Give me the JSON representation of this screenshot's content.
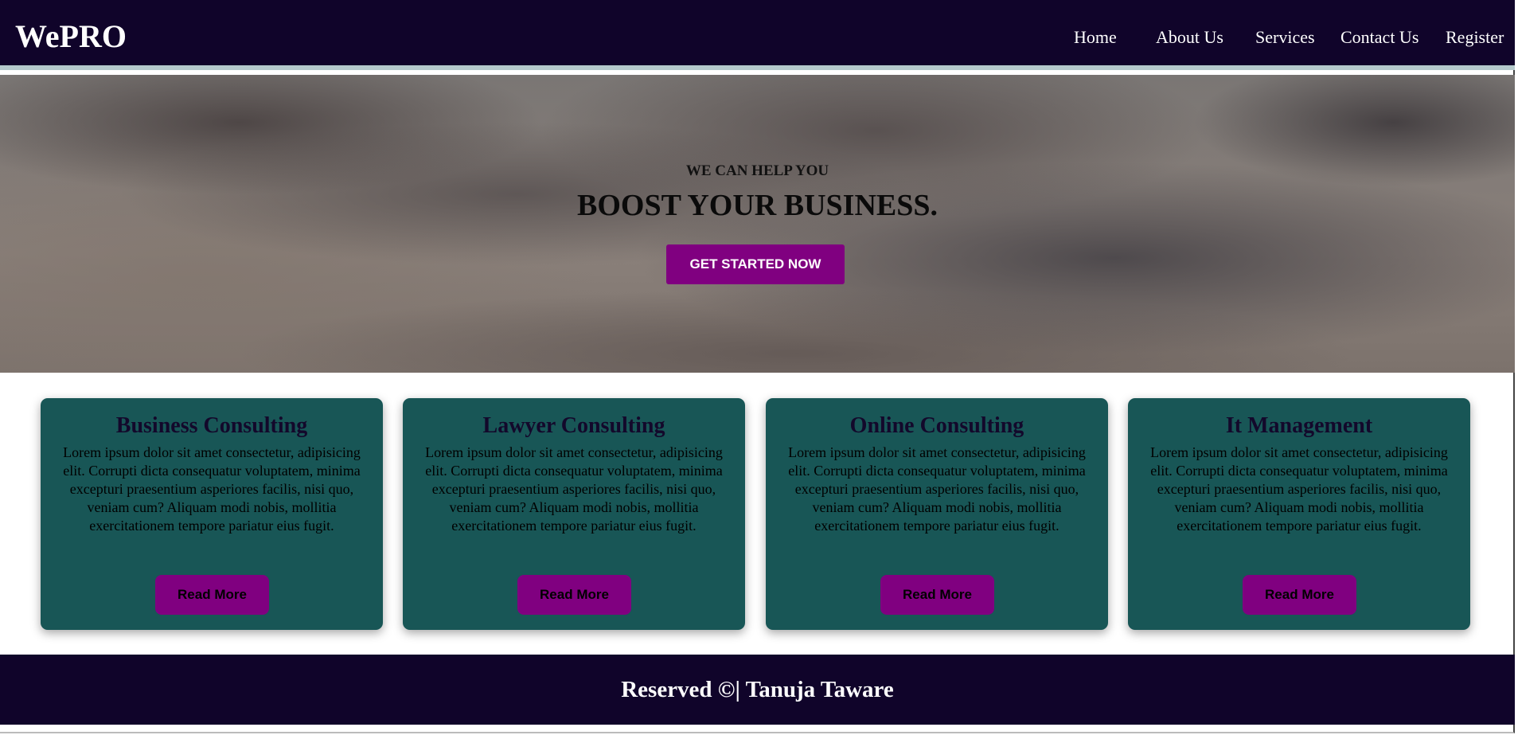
{
  "nav": {
    "logo": "WePRO",
    "links": [
      "Home",
      "About Us",
      "Services",
      "Contact Us",
      "Register"
    ]
  },
  "hero": {
    "subtitle": "WE CAN HELP YOU",
    "title": "BOOST YOUR BUSINESS.",
    "cta": "GET STARTED NOW"
  },
  "cards": [
    {
      "title": "Business Consulting",
      "text": "Lorem ipsum dolor sit amet consectetur, adipisicing elit. Corrupti dicta consequatur voluptatem, minima excepturi praesentium asperiores facilis, nisi quo, veniam cum? Aliquam modi nobis, mollitia exercitationem tempore pariatur eius fugit.",
      "button": "Read More"
    },
    {
      "title": "Lawyer Consulting",
      "text": "Lorem ipsum dolor sit amet consectetur, adipisicing elit. Corrupti dicta consequatur voluptatem, minima excepturi praesentium asperiores facilis, nisi quo, veniam cum? Aliquam modi nobis, mollitia exercitationem tempore pariatur eius fugit.",
      "button": "Read More"
    },
    {
      "title": "Online Consulting",
      "text": "Lorem ipsum dolor sit amet consectetur, adipisicing elit. Corrupti dicta consequatur voluptatem, minima excepturi praesentium asperiores facilis, nisi quo, veniam cum? Aliquam modi nobis, mollitia exercitationem tempore pariatur eius fugit.",
      "button": "Read More"
    },
    {
      "title": "It Management",
      "text": "Lorem ipsum dolor sit amet consectetur, adipisicing elit. Corrupti dicta consequatur voluptatem, minima excepturi praesentium asperiores facilis, nisi quo, veniam cum? Aliquam modi nobis, mollitia exercitationem tempore pariatur eius fugit.",
      "button": "Read More"
    }
  ],
  "footer": {
    "text": "Reserved ©| Tanuja Taware"
  },
  "colors": {
    "nav": "#10042a",
    "accent": "#800080",
    "card": "#185656"
  }
}
